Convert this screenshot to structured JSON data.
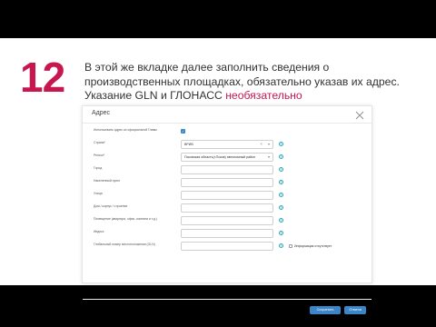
{
  "step_number": "12",
  "instruction": {
    "main": "В этой же вкладке далее заполнить сведения о производственных площадках, обязательно указав их адрес. Указание GLN и ГЛОНАСС ",
    "highlight": "необязательно"
  },
  "dialog": {
    "title": "Адрес",
    "rows": [
      {
        "label": "Использовать адрес из официальной Главы",
        "type": "checkbox"
      },
      {
        "label": "Страна*",
        "type": "select",
        "value": "ВРИВ"
      },
      {
        "label": "Регион*",
        "type": "select",
        "value": "Псковская область(г.Псков) автономный район"
      },
      {
        "label": "Город",
        "type": "input",
        "value": ""
      },
      {
        "label": "Населенный пункт",
        "type": "input",
        "value": ""
      },
      {
        "label": "Улица",
        "type": "input",
        "value": ""
      },
      {
        "label": "Дом / корпус / строение",
        "type": "input",
        "value": ""
      },
      {
        "label": "Помещение (квартира, офис, комната и т.д.)",
        "type": "input",
        "value": ""
      },
      {
        "label": "Индекс",
        "type": "input",
        "value": ""
      },
      {
        "label": "Глобальный номер местоположения (GLN)",
        "type": "input",
        "value": "",
        "extra": "Информация отсутствует"
      }
    ],
    "save_label": "Сохранить",
    "cancel_label": "Отмена"
  }
}
